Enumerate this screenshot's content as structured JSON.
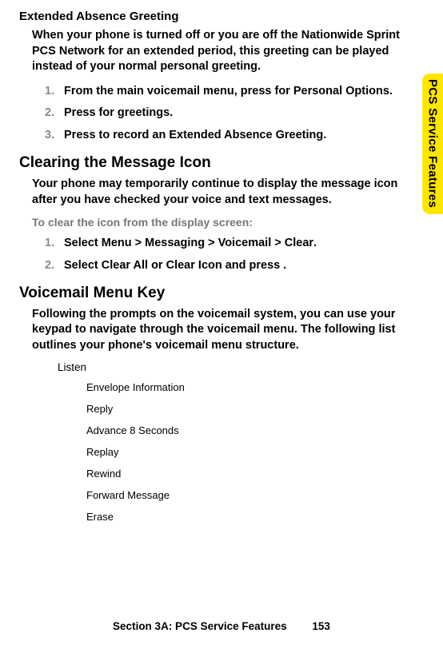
{
  "sideTab": "PCS Service Features",
  "h_ext": "Extended Absence Greeting",
  "p_ext": "When your phone is turned off or you are off the Nationwide Sprint PCS Network for an extended period, this greeting can be played instead of your normal personal greeting.",
  "steps_ext": [
    {
      "n": "1.",
      "pre": "From the main voicemail menu, press ",
      "post": " for Personal Options."
    },
    {
      "n": "2.",
      "pre": "Press ",
      "post": " for greetings."
    },
    {
      "n": "3.",
      "pre": "Press ",
      "post": " to record an Extended Absence Greeting."
    }
  ],
  "h_clear": "Clearing the Message Icon",
  "p_clear": "Your phone may temporarily continue to display the message icon after you have checked your voice and text messages.",
  "lead_clear": "To clear the icon from the display screen:",
  "steps_clear": [
    {
      "n": "1.",
      "parts": [
        "Select ",
        "Menu",
        " > ",
        "Messaging",
        " > ",
        "Voicemail",
        " > ",
        "Clear",
        "."
      ]
    },
    {
      "n": "2.",
      "parts": [
        "Select ",
        "Clear All",
        " or ",
        "Clear Icon",
        " and press ",
        "",
        "."
      ]
    }
  ],
  "h_vm": "Voicemail Menu Key",
  "p_vm": "Following the prompts on the voicemail system, you can use your keypad to navigate through the voicemail menu. The following list outlines your phone's voicemail menu structure.",
  "menu_top": "Listen",
  "menu_items": [
    "Envelope Information",
    "Reply",
    "Advance 8 Seconds",
    "Replay",
    "Rewind",
    "Forward Message",
    "Erase"
  ],
  "footer_section": "Section 3A: PCS Service Features",
  "footer_page": "153"
}
